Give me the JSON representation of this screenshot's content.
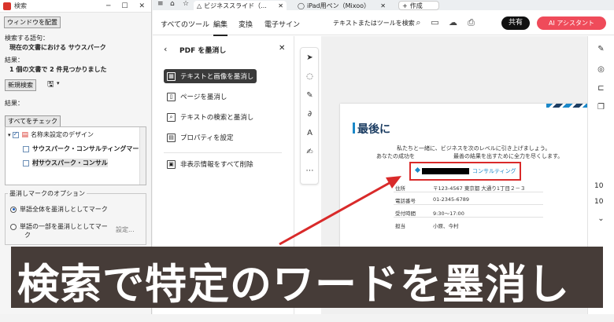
{
  "search_window": {
    "title": "検索",
    "arrange_button": "ウィンドウを配置",
    "query_label": "検索する語句：",
    "query_text": "現在の文書における サウスパーク",
    "results_label": "結果：",
    "results_text": "1 個の文書で 2 件見つかりました",
    "new_search_button": "新規検索",
    "results_label_2": "結果：",
    "check_all_button": "すべてをチェック",
    "tree": {
      "root": "名称未設定のデザイン",
      "items": [
        "サウスパーク・コンサルティングマーク",
        "村サウスパーク・コンサル"
      ]
    },
    "options_title": "墨消しマークのオプション",
    "option_whole": "単語全体を墨消しとしてマーク",
    "option_part_line1": "単語の一部を墨消しとしてマー",
    "option_part_line2": "ク",
    "settings_button": "設定..."
  },
  "browser": {
    "tabs": [
      {
        "label": "ビジネススライド（..."
      },
      {
        "label": "iPad用ペン（Mixoo）"
      },
      {
        "label": "作成"
      }
    ],
    "menu": [
      "すべてのツール",
      "編集",
      "変換",
      "電子サイン"
    ],
    "search_tools_placeholder": "テキストまたはツールを検索",
    "share_button": "共有",
    "ai_button": "AI アシスタント"
  },
  "redact_panel": {
    "title": "PDF を墨消し",
    "items": [
      "テキストと画像を墨消し",
      "ページを墨消し",
      "テキストの検索と墨消し",
      "プロパティを設定",
      "非表示情報をすべて削除"
    ]
  },
  "document": {
    "title": "最後に",
    "paragraph_1": "私たちと一緒に、ビジネスを次のレベルに引き上げましょう。",
    "paragraph_2_left": "あなたの成功を",
    "paragraph_2_right": "最善の結果を出すために全力を尽くします。",
    "company_suffix": "コンサルティング",
    "rows": [
      {
        "label": "住所",
        "value": "〒123-4567 東京都 大通り1丁目２－３"
      },
      {
        "label": "電話番号",
        "value": "01-2345-6789"
      },
      {
        "label": "受付時間",
        "value": "9:30～17:00"
      },
      {
        "label": "担当",
        "value": "小原、今村"
      }
    ]
  },
  "right_panel": {
    "page_number": "10",
    "page_total": "10"
  },
  "banner": {
    "text": "検索で特定のワードを墨消し"
  },
  "colors": {
    "banner_bg": "#463c38",
    "accent_red": "#d92a2a",
    "ai_button": "#ef4b5a",
    "doc_accent": "#1b88c8",
    "doc_navy": "#1d3e63"
  }
}
